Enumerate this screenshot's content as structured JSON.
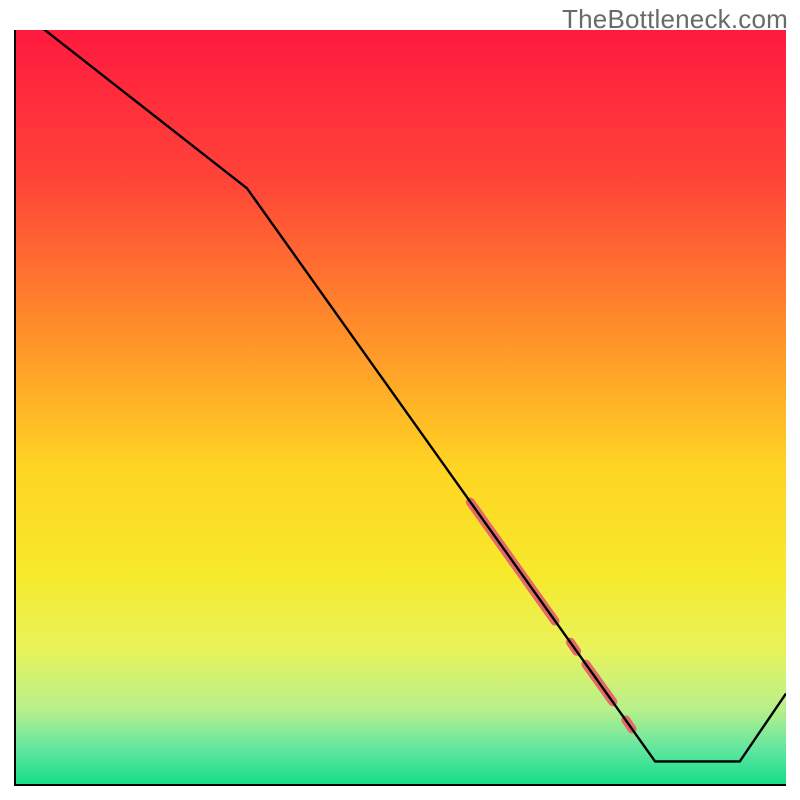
{
  "watermark": "TheBottleneck.com",
  "chart_data": {
    "type": "line",
    "title": "",
    "xlabel": "",
    "ylabel": "",
    "xlim": [
      0,
      100
    ],
    "ylim": [
      0,
      100
    ],
    "grid": false,
    "series": [
      {
        "name": "bottleneck-curve",
        "x": [
          0,
          30,
          83,
          94,
          100
        ],
        "y": [
          103,
          79,
          3,
          3,
          12
        ]
      }
    ],
    "highlights": [
      {
        "name": "segment-a",
        "x0": 59,
        "y0": 37.4,
        "x1": 70,
        "y1": 21.6,
        "width": 9
      },
      {
        "name": "dot-b",
        "x0": 72,
        "y0": 18.8,
        "x1": 72.8,
        "y1": 17.6,
        "width": 9
      },
      {
        "name": "segment-c",
        "x0": 74,
        "y0": 15.9,
        "x1": 77.5,
        "y1": 10.9,
        "width": 9
      },
      {
        "name": "dot-d",
        "x0": 79.2,
        "y0": 8.5,
        "x1": 80.0,
        "y1": 7.3,
        "width": 9
      }
    ],
    "gradient_stops": [
      {
        "offset": 0,
        "color": "#ff1a3f"
      },
      {
        "offset": 0.2,
        "color": "#ff4438"
      },
      {
        "offset": 0.4,
        "color": "#ff8f2a"
      },
      {
        "offset": 0.58,
        "color": "#ffd423"
      },
      {
        "offset": 0.72,
        "color": "#f7e92b"
      },
      {
        "offset": 0.82,
        "color": "#e9f35a"
      },
      {
        "offset": 0.9,
        "color": "#b9f08a"
      },
      {
        "offset": 0.955,
        "color": "#5fe6a0"
      },
      {
        "offset": 1.0,
        "color": "#17dd88"
      }
    ],
    "line_color": "#000000",
    "highlight_color": "#e46a6a"
  }
}
